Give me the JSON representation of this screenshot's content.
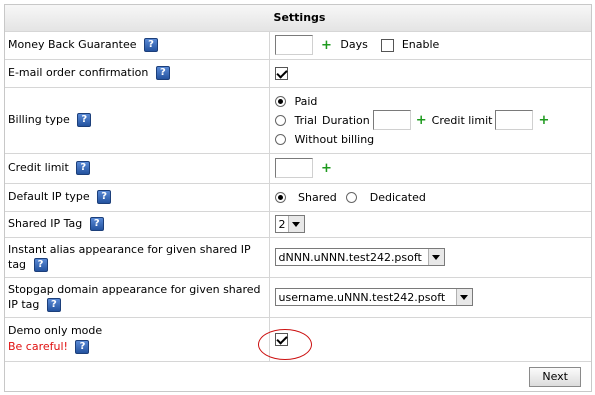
{
  "header": {
    "title": "Settings"
  },
  "rows": {
    "money_back": {
      "label": "Money Back Guarantee",
      "value": "",
      "days_label": "Days",
      "enable_label": "Enable",
      "enabled": false
    },
    "email_conf": {
      "label": "E-mail order confirmation",
      "checked": true
    },
    "billing": {
      "label": "Billing type",
      "options": {
        "paid": "Paid",
        "trial": "Trial",
        "without": "Without billing"
      },
      "selected": "paid",
      "duration_label": "Duration",
      "credit_limit_label": "Credit limit"
    },
    "credit_limit": {
      "label": "Credit limit",
      "value": ""
    },
    "ip_type": {
      "label": "Default IP type",
      "shared": "Shared",
      "dedicated": "Dedicated",
      "selected": "shared"
    },
    "shared_ip_tag": {
      "label": "Shared IP Tag",
      "value": "2"
    },
    "instant_alias": {
      "label": "Instant alias appearance for given shared IP tag",
      "value": "dNNN.uNNN.test242.psoft"
    },
    "stopgap": {
      "label": "Stopgap domain appearance for given shared IP tag",
      "value": "username.uNNN.test242.psoft"
    },
    "demo": {
      "label": "Demo only mode",
      "warning": "Be careful!",
      "checked": true
    }
  },
  "help_glyph": "?",
  "footer": {
    "next_label": "Next"
  },
  "colors": {
    "accent_plus": "#1e9a1e",
    "warning": "#e01010",
    "highlight_circle": "#cc1111"
  }
}
